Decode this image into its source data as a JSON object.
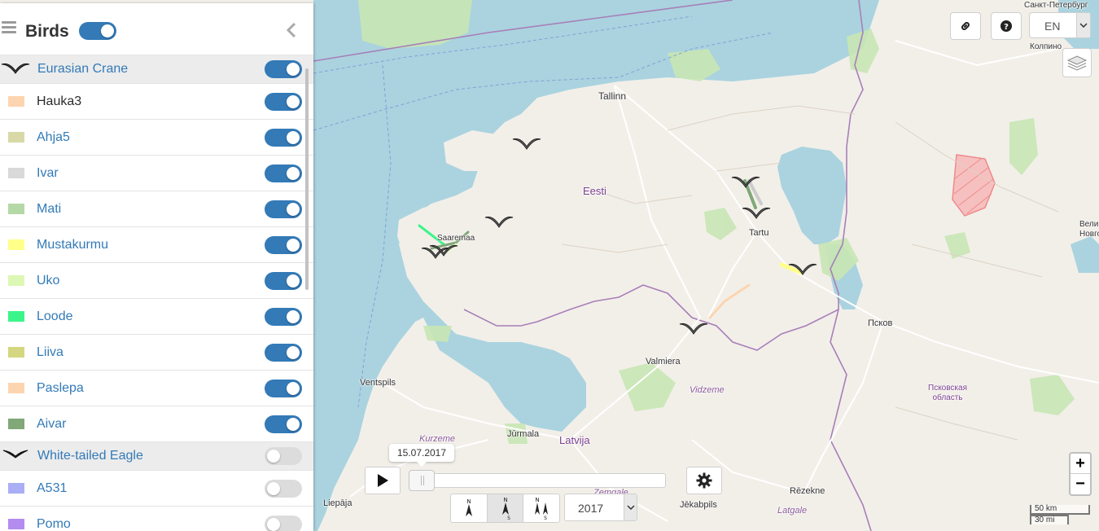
{
  "sidebar": {
    "title": "Birds",
    "title_toggle_on": true,
    "groups": [
      {
        "name": "Eurasian Crane",
        "enabled": true,
        "icon": "crane-icon",
        "birds": [
          {
            "name": "Hauka3",
            "color": "#fcd5b0",
            "enabled": true,
            "dark": true
          },
          {
            "name": "Ahja5",
            "color": "#d9d9a8",
            "enabled": true
          },
          {
            "name": "Ivar",
            "color": "#d9d9d9",
            "enabled": true
          },
          {
            "name": "Mati",
            "color": "#b4d9a6",
            "enabled": true
          },
          {
            "name": "Mustakurmu",
            "color": "#ffff8a",
            "enabled": true
          },
          {
            "name": "Uko",
            "color": "#dcf8b4",
            "enabled": true
          },
          {
            "name": "Loode",
            "color": "#3cf58a",
            "enabled": true
          },
          {
            "name": "Liiva",
            "color": "#d4d680",
            "enabled": true
          },
          {
            "name": "Paslepa",
            "color": "#fcd5b0",
            "enabled": true
          },
          {
            "name": "Aivar",
            "color": "#80a878",
            "enabled": true
          }
        ]
      },
      {
        "name": "White-tailed Eagle",
        "enabled": false,
        "icon": "eagle-icon",
        "birds": [
          {
            "name": "A531",
            "color": "#a9aef5",
            "enabled": false
          },
          {
            "name": "Pomo",
            "color": "#b48cf0",
            "enabled": false
          }
        ]
      }
    ]
  },
  "controls": {
    "language": "EN",
    "date_tooltip": "15.07.2017",
    "year": "2017",
    "timeline_position": 0.0,
    "direction_buttons": [
      {
        "icon": "north-arrow-icon",
        "labels": [
          "N"
        ],
        "active": false
      },
      {
        "icon": "north-south-arrow-icon",
        "labels": [
          "N",
          "S"
        ],
        "active": true
      },
      {
        "icon": "double-north-south-icon",
        "labels": [
          "N",
          "S"
        ],
        "active": false
      }
    ],
    "zoom_in": "+",
    "zoom_out": "−",
    "scale_km": "50 km",
    "scale_mi": "30 mi"
  },
  "map": {
    "labels": {
      "tallinn": "Tallinn",
      "eesti": "Eesti",
      "saaremaa": "Saaremaa",
      "tartu": "Tartu",
      "valmiera": "Valmiera",
      "ventspils": "Ventspils",
      "jurmala": "Jūrmala",
      "latvija": "Latvija",
      "kurzeme": "Kurzeme",
      "vidzeme": "Vidzeme",
      "zemgale": "Zemgale",
      "latgale": "Latgale",
      "liepaja": "Liepāja",
      "jekabpils": "Jēkabpils",
      "rezekne": "Rēzekne",
      "pskov": "Псков",
      "pskov_oblast_1": "Псковская",
      "pskov_oblast_2": "область",
      "spb": "Санкт-Петербург",
      "kolpino": "Колпино",
      "veliky_1": "Вели",
      "veliky_2": "Новго"
    },
    "colors": {
      "sea": "#aad3df",
      "land": "#f2efe9",
      "forest": "#c8e6b4",
      "border": "#a87fb8",
      "road": "#ffffff"
    }
  }
}
